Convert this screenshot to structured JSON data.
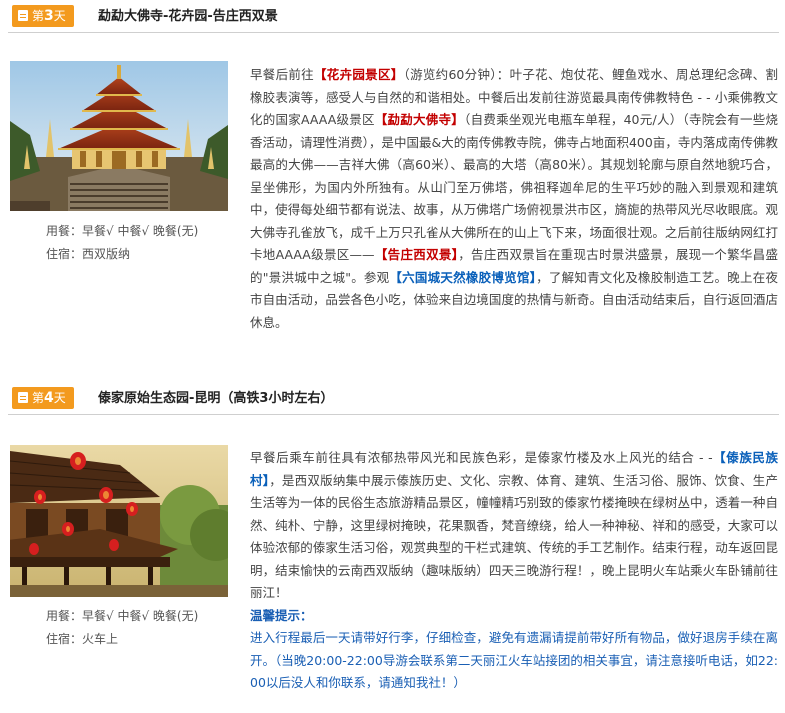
{
  "day3": {
    "badge_prefix": "第",
    "badge_num": "3",
    "badge_suffix": "天",
    "title": "勐勐大佛寺-花卉园-告庄西双景",
    "meals": "用餐：早餐√ 中餐√ 晚餐(无)",
    "lodging": "住宿：西双版纳",
    "desc": {
      "p1": "早餐后前往",
      "h1": "【花卉园景区】",
      "p2": "（游览约60分钟）：叶子花、炮仗花、鲤鱼戏水、周总理纪念碑、割橡胶表演等，感受人与自然的和谐相处。中餐后出发前往游览最具南传佛教特色 - - 小乘佛教文化的国家AAAA级景区",
      "h2": "【勐勐大佛寺】",
      "p3": "（自费乘坐观光电瓶车单程，40元/人）（寺院会有一些烧香活动，请理性消费），是中国最&大的南传佛教寺院，佛寺占地面积400亩，寺内落成南传佛教最高的大佛——吉祥大佛（高60米）、最高的大塔（高80米）。其规划轮廓与原自然地貌巧合，呈坐佛形，为国内外所独有。从山门至万佛塔，佛祖释迦牟尼的生平巧妙的融入到景观和建筑中，使得每处细节都有说法、故事，从万佛塔广场俯视景洪市区，旖旎的热带风光尽收眼底。观大佛寺孔雀放飞，成千上万只孔雀从大佛所在的山上飞下来，场面很壮观。之后前往版纳网红打卡地AAAA级景区——",
      "h3": "【告庄西双景】",
      "p4": "，告庄西双景旨在重现古时景洪盛景，展现一个繁华昌盛的\"景洪城中之城\"。参观",
      "h4": "【六国城天然橡胶博览馆】",
      "p5": "，了解知青文化及橡胶制造工艺。晚上在夜市自由活动，品尝各色小吃，体验来自边境国度的热情与新奇。自由活动结束后，自行返回酒店休息。"
    }
  },
  "day4": {
    "badge_prefix": "第",
    "badge_num": "4",
    "badge_suffix": "天",
    "title": "傣家原始生态园-昆明（高铁3小时左右）",
    "meals": "用餐：早餐√ 中餐√ 晚餐(无)",
    "lodging": "住宿：火车上",
    "desc": {
      "p1": "早餐后乘车前往具有浓郁热带风光和民族色彩，是傣家竹楼及水上风光的结合 - -",
      "h1": "【傣族民族村】",
      "p2": "，是西双版纳集中展示傣族历史、文化、宗教、体育、建筑、生活习俗、服饰、饮食、生产生活等为一体的民俗生态旅游精品景区，幢幢精巧别致的傣家竹楼掩映在绿树丛中，透着一种自然、纯朴、宁静，这里绿树掩映，花果飘香，梵音缭绕，给人一种神秘、祥和的感受，大家可以体验浓郁的傣家生活习俗，观赏典型的干栏式建筑、传统的手工艺制作。结束行程，动车返回昆明，结束愉快的云南西双版纳（趣味版纳）四天三晚游行程！，晚上昆明火车站乘火车卧铺前往丽江！",
      "tip_title": "温馨提示：",
      "tip_body": "进入行程最后一天请带好行李，仔细检查，避免有遗漏请提前带好所有物品，做好退房手续在离开。（当晚20:00-22:00导游会联系第二天丽江火车站接团的相关事宜，请注意接听电话，如22:00以后没人和你联系，请通知我社！）"
    }
  },
  "colors": {
    "badge": "#f39a1e",
    "highlight_red": "#c30000",
    "highlight_blue": "#0a60ba",
    "tip_blue": "#1a5fb4"
  }
}
